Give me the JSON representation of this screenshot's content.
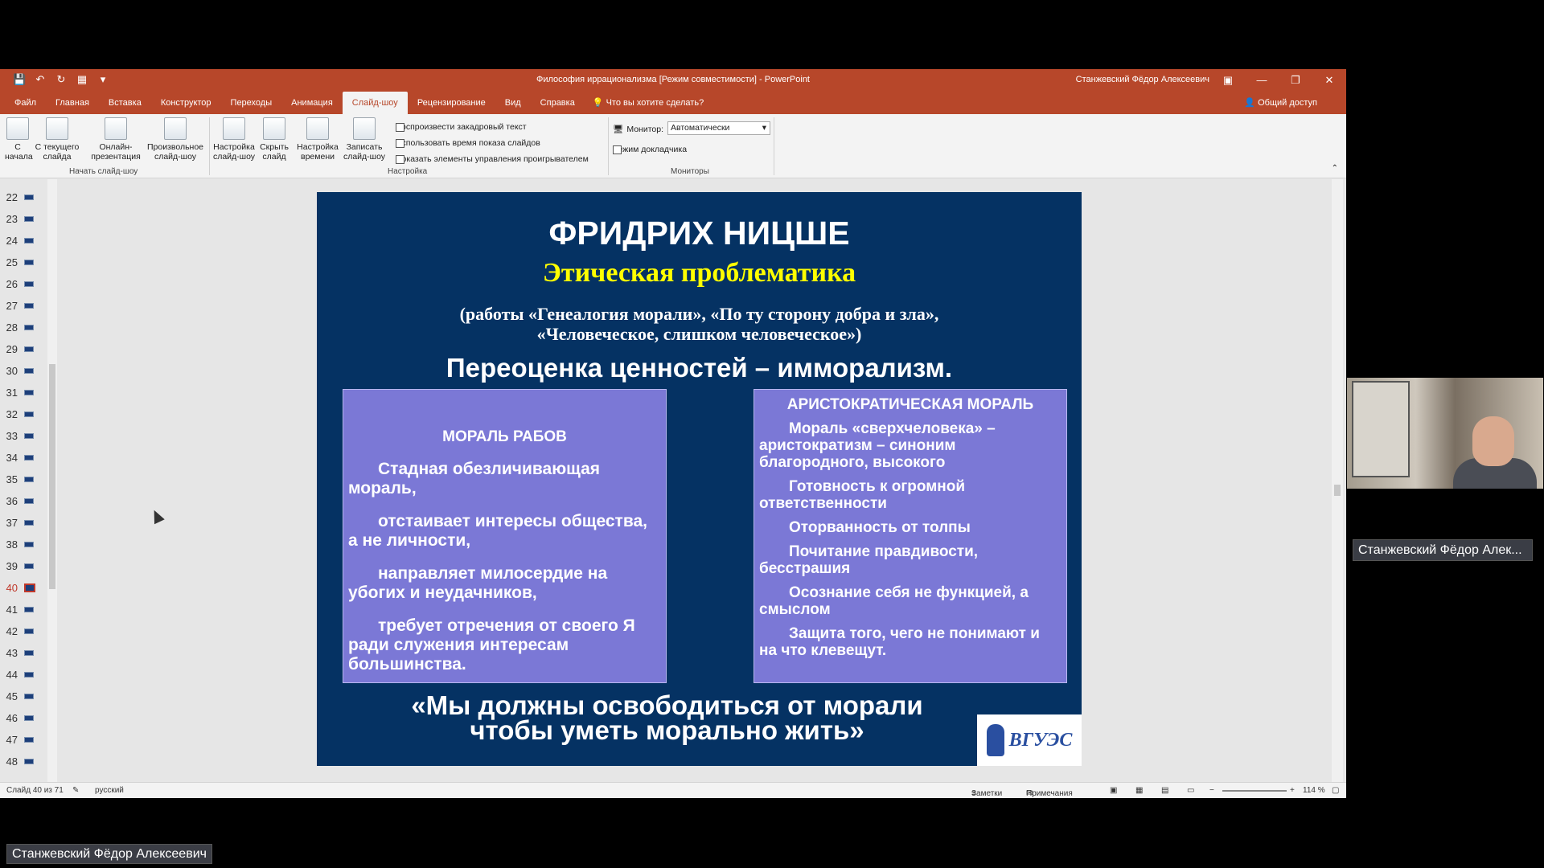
{
  "window": {
    "title": "Философия иррационализма [Режим совместимости] - PowerPoint",
    "user": "Станжевский Фёдор Алексеевич"
  },
  "menu": {
    "tabs": [
      "Файл",
      "Главная",
      "Вставка",
      "Конструктор",
      "Переходы",
      "Анимация",
      "Слайд-шоу",
      "Рецензирование",
      "Вид",
      "Справка"
    ],
    "active_tab": "Слайд-шоу",
    "tell_me": "Что вы хотите сделать?",
    "share": "Общий доступ"
  },
  "ribbon": {
    "start": {
      "from_beginning": "С начала",
      "from_current": "С текущего слайда",
      "online": "Онлайн-презентация",
      "custom": "Произвольное слайд-шоу",
      "group_label": "Начать слайд-шоу"
    },
    "setup": {
      "setup_show": "Настройка слайд-шоу",
      "hide_slide": "Скрыть слайд",
      "rehearse": "Настройка времени",
      "record": "Записать слайд-шоу",
      "play_narrations": "Воспроизвести закадровый текст",
      "use_timings": "Использовать время показа слайдов",
      "show_media_controls": "Показать элементы управления проигрывателем",
      "group_label": "Настройка"
    },
    "monitors": {
      "monitor_label": "Монитор:",
      "monitor_value": "Автоматически",
      "presenter_view": "Режим докладчика",
      "group_label": "Мониторы"
    }
  },
  "thumbnails": [
    "22",
    "23",
    "24",
    "25",
    "26",
    "27",
    "28",
    "29",
    "30",
    "31",
    "32",
    "33",
    "34",
    "35",
    "36",
    "37",
    "38",
    "39",
    "40",
    "41",
    "42",
    "43",
    "44",
    "45",
    "46",
    "47",
    "48"
  ],
  "active_thumbnail": "40",
  "slide": {
    "title": "ФРИДРИХ НИЦШЕ",
    "subtitle": "Этическая проблематика",
    "works_line1": "(работы «Генеалогия морали», «По ту сторону добра и зла»,",
    "works_line2": "«Человеческое, слишком человеческое»)",
    "revaluation": "Переоценка ценностей – имморализм.",
    "left_box": {
      "heading": "МОРАЛЬ РАБОВ",
      "items": [
        "Стадная обезличивающая мораль,",
        "отстаивает интересы общества, а не личности,",
        "направляет милосердие на убогих и неудачников,",
        "требует отречения от своего Я ради служения интересам большинства."
      ]
    },
    "right_box": {
      "heading": "АРИСТОКРАТИЧЕСКАЯ МОРАЛЬ",
      "items": [
        "Мораль «сверхчеловека» – аристократизм – синоним благородного,  высокого",
        "Готовность к огромной ответственности",
        "Оторванность от толпы",
        "Почитание правдивости, бесстрашия",
        "Осознание себя не функцией, а смыслом",
        "Защита того, чего не понимают и на что клевещут."
      ]
    },
    "quote_line1": "«Мы должны освободиться от морали",
    "quote_line2": "чтобы уметь морально жить»",
    "logo_text": "ВГУЭС"
  },
  "statusbar": {
    "slide_counter": "Слайд 40 из 71",
    "language": "русский",
    "notes": "Заметки",
    "comments": "Примечания",
    "zoom": "114 %"
  },
  "participant": {
    "right_label": "Станжевский Фёдор Алек...",
    "bottom_label": "Станжевский Фёдор Алексеевич"
  }
}
